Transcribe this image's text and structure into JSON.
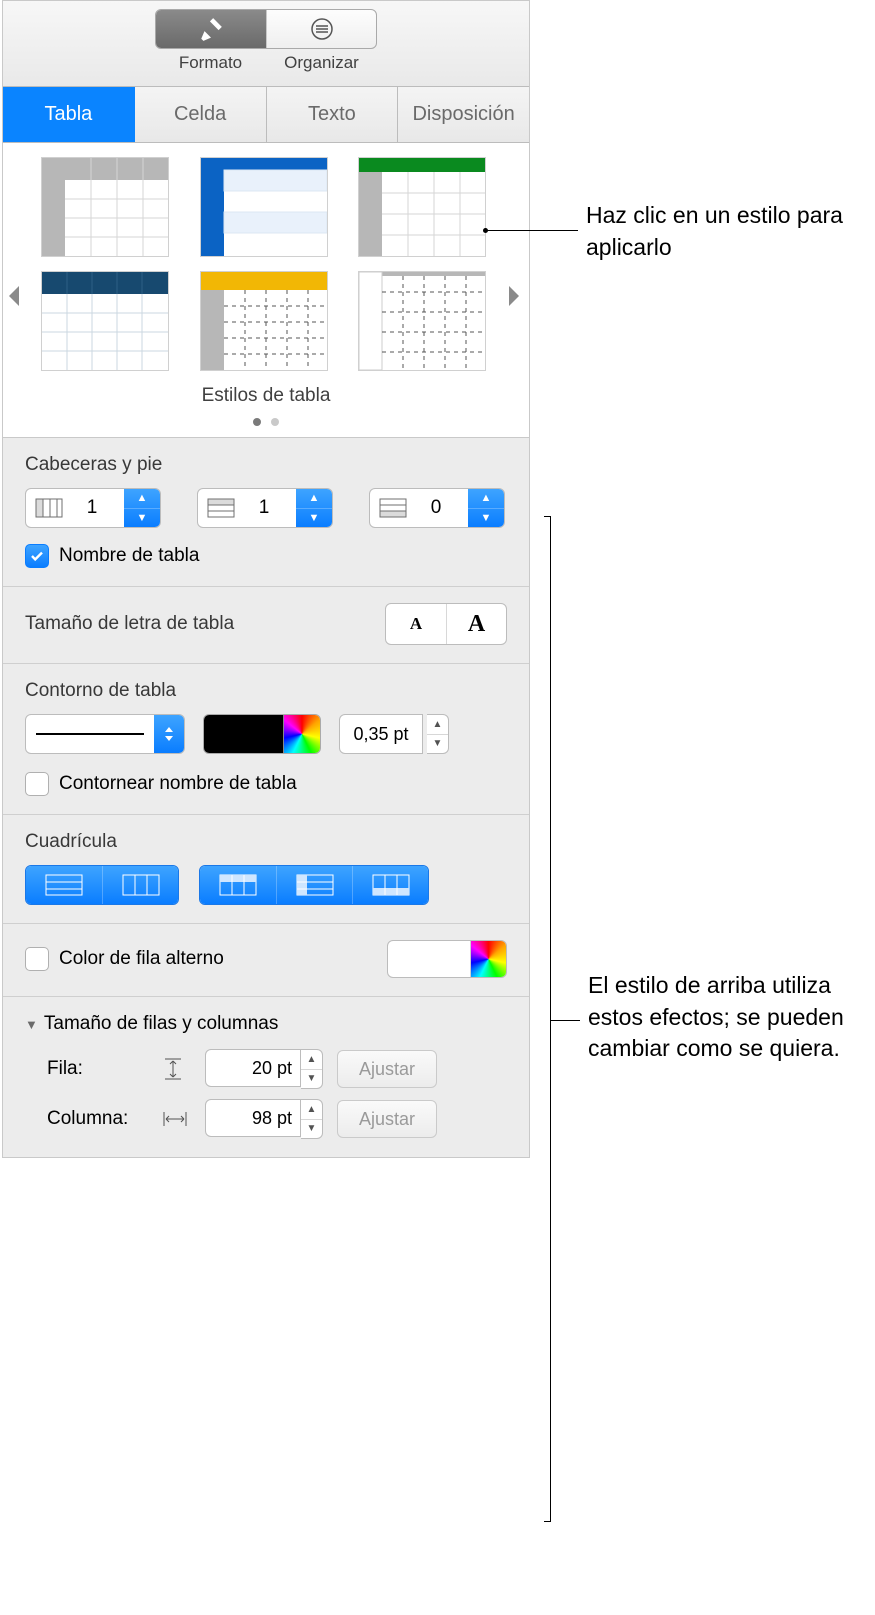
{
  "toolbar": {
    "formato": "Formato",
    "organizar": "Organizar"
  },
  "tabs": {
    "tabla": "Tabla",
    "celda": "Celda",
    "texto": "Texto",
    "disposicion": "Disposición"
  },
  "styles": {
    "caption": "Estilos de tabla"
  },
  "headers": {
    "title": "Cabeceras y pie",
    "col_headers": "1",
    "row_headers": "1",
    "footers": "0",
    "table_name_checked": true,
    "table_name_label": "Nombre de tabla"
  },
  "font_size": {
    "title": "Tamaño de letra de tabla",
    "small": "A",
    "large": "A"
  },
  "outline": {
    "title": "Contorno de tabla",
    "width": "0,35 pt",
    "outline_name_label": "Contornear nombre de tabla",
    "outline_name_checked": false
  },
  "grid": {
    "title": "Cuadrícula"
  },
  "alt_row": {
    "label": "Color de fila alterno",
    "checked": false
  },
  "rowcol": {
    "title": "Tamaño de filas y columnas",
    "row_label": "Fila:",
    "col_label": "Columna:",
    "row_value": "20 pt",
    "col_value": "98 pt",
    "fit": "Ajustar"
  },
  "callouts": {
    "style_click": "Haz clic en un estilo para aplicarlo",
    "effects": "El estilo de arriba utiliza estos efectos; se pueden cambiar como se quiera."
  }
}
